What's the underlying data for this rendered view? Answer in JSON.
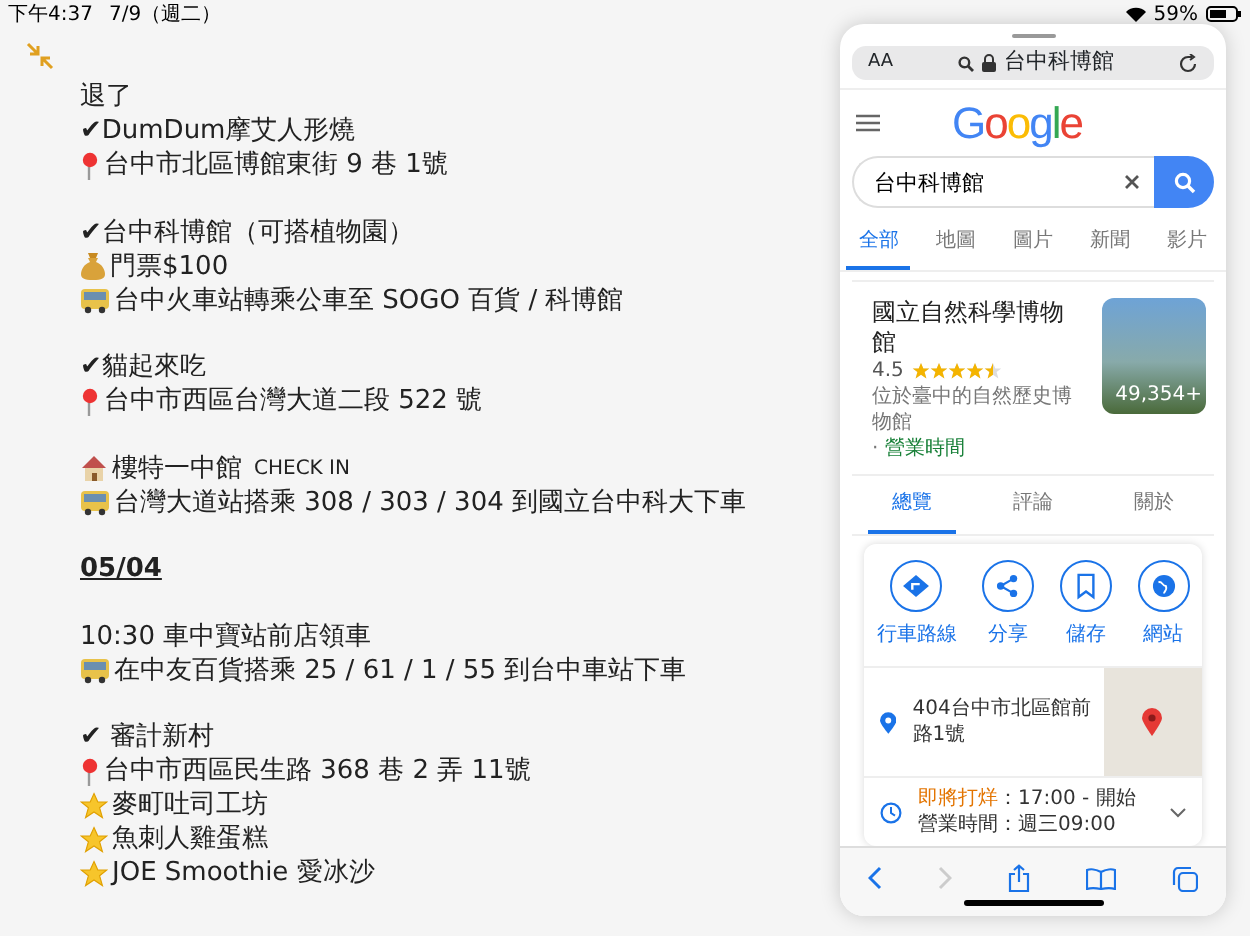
{
  "status_bar": {
    "time": "下午4:37",
    "date": "7/9（週二）",
    "battery": "59%"
  },
  "note": {
    "lines": [
      {
        "kind": "text",
        "text": "退了"
      },
      {
        "kind": "text",
        "text": "✔DumDum摩艾人形燒"
      },
      {
        "kind": "pin",
        "text": "台中市北區博館東街 9 巷 1號"
      },
      {
        "kind": "blank"
      },
      {
        "kind": "text",
        "text": "✔台中科博館（可搭植物園）"
      },
      {
        "kind": "money",
        "text": "門票$100"
      },
      {
        "kind": "bus",
        "text": "台中火車站轉乘公車至 SOGO 百貨 / 科博館"
      },
      {
        "kind": "blank"
      },
      {
        "kind": "text",
        "text": "✔貓起來吃"
      },
      {
        "kind": "pin",
        "text": "台中市西區台灣大道二段 522 號"
      },
      {
        "kind": "blank"
      },
      {
        "kind": "house",
        "text": "樓特一中館",
        "tag": "CHECK IN"
      },
      {
        "kind": "bus",
        "text": "台灣大道站搭乘 308 / 303 / 304 到國立台中科大下車"
      },
      {
        "kind": "blank"
      },
      {
        "kind": "date",
        "text": "05/04"
      },
      {
        "kind": "blank"
      },
      {
        "kind": "text",
        "text": "10:30 車中寶站前店領車"
      },
      {
        "kind": "bus",
        "text": "在中友百貨搭乘 25 / 61 / 1 / 55 到台中車站下車"
      },
      {
        "kind": "blank"
      },
      {
        "kind": "text",
        "text": "✔ 審計新村"
      },
      {
        "kind": "pin",
        "text": "台中市西區民生路 368 巷 2 弄 11號"
      },
      {
        "kind": "star",
        "text": "麥町吐司工坊"
      },
      {
        "kind": "star",
        "text": "魚刺人雞蛋糕"
      },
      {
        "kind": "star",
        "text": "JOE Smoothie 愛冰沙"
      }
    ]
  },
  "browser": {
    "address": "台中科博館",
    "text_size": "AA",
    "logo": "Google",
    "search": {
      "value": "台中科博館"
    },
    "tabs": [
      {
        "label": "全部",
        "selected": true
      },
      {
        "label": "地圖",
        "selected": false
      },
      {
        "label": "圖片",
        "selected": false
      },
      {
        "label": "新聞",
        "selected": false
      },
      {
        "label": "影片",
        "selected": false
      }
    ],
    "result": {
      "title": "國立自然科學博物館",
      "rating": "4.5",
      "stars": 4.5,
      "description": "位於臺中的自然歷史博物館",
      "separator": "·",
      "hours_link": "營業時間",
      "photo_count": "49,354+",
      "tabs": [
        {
          "label": "總覽",
          "selected": true
        },
        {
          "label": "評論",
          "selected": false
        },
        {
          "label": "關於",
          "selected": false
        }
      ],
      "actions": [
        {
          "kind": "directions",
          "label": "行車路線"
        },
        {
          "kind": "share",
          "label": "分享"
        },
        {
          "kind": "save",
          "label": "儲存"
        },
        {
          "kind": "website",
          "label": "網站"
        }
      ],
      "address": "404台中市北區館前路1號",
      "hours_status": "即將打烊",
      "hours_detail": "：17:00 - 開始",
      "hours_next": "營業時間：週三09:00"
    }
  }
}
